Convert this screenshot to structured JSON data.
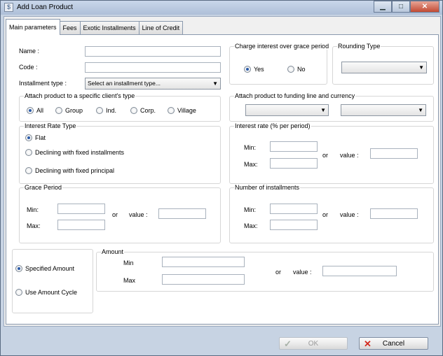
{
  "window": {
    "title": "Add Loan Product"
  },
  "tabs": [
    "Main parameters",
    "Fees",
    "Exotic Installments",
    "Line of Credit"
  ],
  "main": {
    "name_label": "Name :",
    "code_label": "Code :",
    "installment_label": "Installment type :",
    "installment_value": "Select an installment type...",
    "charge_title": "Charge interest over grace period",
    "charge_yes": "Yes",
    "charge_no": "No",
    "rounding_title": "Rounding Type",
    "client_type_title": "Attach product to a specific client's type",
    "client_types": [
      "All",
      "Group",
      "Ind.",
      "Corp.",
      "Village"
    ],
    "funding_title": "Attach product to funding line and currency",
    "rate_type_title": "Interest Rate Type",
    "rate_types": [
      "Flat",
      "Declining with fixed installments",
      "Declining with fixed principal"
    ],
    "interest_title": "Interest rate (% per period)",
    "grace_title": "Grace Period",
    "installments_title": "Number of installments",
    "min_label": "Min:",
    "max_label": "Max:",
    "or_label": "or",
    "value_label": "value :",
    "amount_types": [
      "Specified Amount",
      "Use Amount Cycle"
    ],
    "amount_title": "Amount",
    "amount_min_label": "Min",
    "amount_max_label": "Max"
  },
  "footer": {
    "ok": "OK",
    "cancel": "Cancel"
  }
}
